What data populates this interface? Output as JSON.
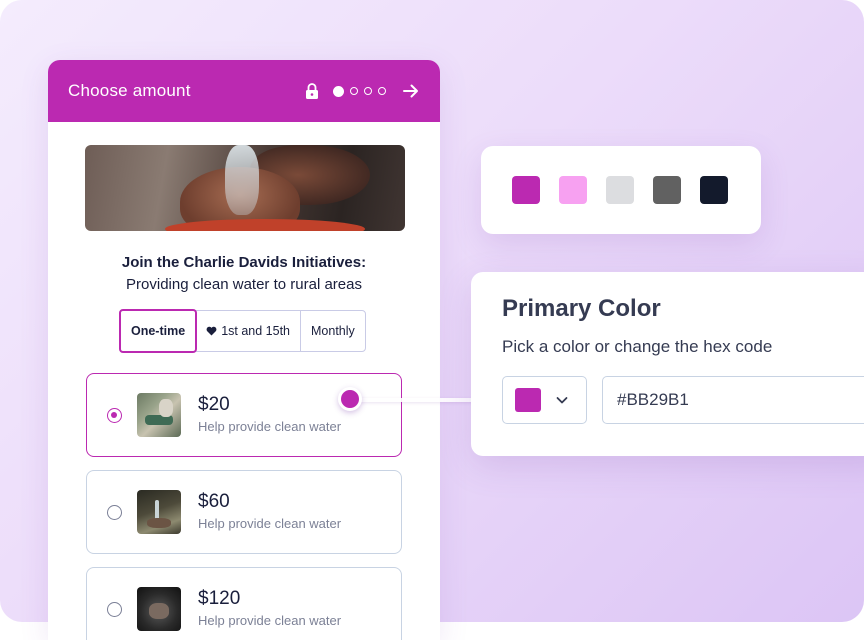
{
  "colors": {
    "brand": "#BB29B1"
  },
  "header": {
    "title": "Choose amount",
    "icons": [
      "lock-icon",
      "step-dots",
      "arrow-right-icon"
    ],
    "current_step": 1,
    "total_steps": 4
  },
  "campaign": {
    "headline_line1": "Join the Charlie Davids Initiatives:",
    "headline_line2": "Providing clean water to rural areas"
  },
  "frequency": {
    "selected": "One-time",
    "options": [
      {
        "label": "One-time"
      },
      {
        "label": "1st and 15th",
        "icon": "heart-icon"
      },
      {
        "label": "Monthly"
      }
    ]
  },
  "amounts": [
    {
      "amount": "$20",
      "description": "Help provide clean water",
      "selected": true
    },
    {
      "amount": "$60",
      "description": "Help provide clean water",
      "selected": false
    },
    {
      "amount": "$120",
      "description": "Help provide clean water",
      "selected": false
    }
  ],
  "swatches": [
    "#BB29B1",
    "#F7A1F1",
    "#DCDDE0",
    "#616161",
    "#131A2C"
  ],
  "primary_color": {
    "title": "Primary Color",
    "subtitle": "Pick a color or change the hex code",
    "hex_value": "#BB29B1"
  }
}
